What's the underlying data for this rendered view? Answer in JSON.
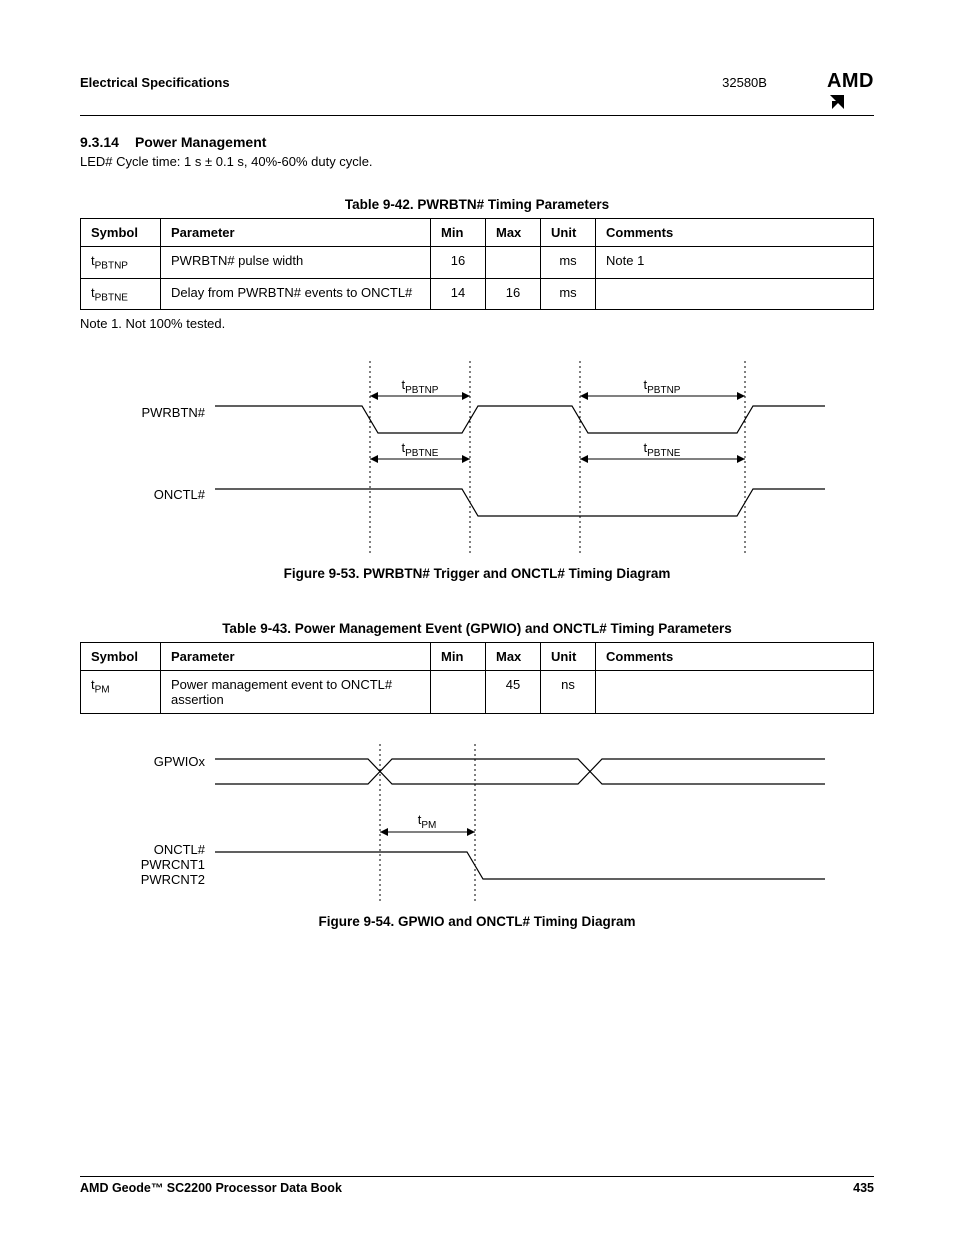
{
  "header": {
    "left": "Electrical Specifications",
    "docnum": "32580B",
    "logo": "AMD"
  },
  "section": {
    "num": "9.3.14",
    "title": "Power Management",
    "body": "LED# Cycle time: 1 s ± 0.1 s, 40%-60% duty cycle."
  },
  "table42": {
    "title": "Table 9-42.  PWRBTN# Timing Parameters",
    "headers": [
      "Symbol",
      "Parameter",
      "Min",
      "Max",
      "Unit",
      "Comments"
    ],
    "rows": [
      {
        "sym_base": "t",
        "sym_sub": "PBTNP",
        "param": "PWRBTN# pulse width",
        "min": "16",
        "max": "",
        "unit": "ms",
        "comm": "Note 1"
      },
      {
        "sym_base": "t",
        "sym_sub": "PBTNE",
        "param": "Delay from PWRBTN# events to ONCTL#",
        "min": "14",
        "max": "16",
        "unit": "ms",
        "comm": ""
      }
    ],
    "note": "Note 1.   Not 100% tested."
  },
  "figure53": {
    "caption": "Figure 9-53.  PWRBTN# Trigger and ONCTL# Timing Diagram",
    "signals": {
      "s1": "PWRBTN#",
      "s2": "ONCTL#"
    },
    "labels": {
      "t1_base": "t",
      "t1_sub": "PBTNP",
      "t2_base": "t",
      "t2_sub": "PBTNE"
    }
  },
  "table43": {
    "title": "Table 9-43.  Power Management Event (GPWIO) and ONCTL# Timing Parameters",
    "headers": [
      "Symbol",
      "Parameter",
      "Min",
      "Max",
      "Unit",
      "Comments"
    ],
    "rows": [
      {
        "sym_base": "t",
        "sym_sub": "PM",
        "param": "Power management event to ONCTL# assertion",
        "min": "",
        "max": "45",
        "unit": "ns",
        "comm": ""
      }
    ]
  },
  "figure54": {
    "caption": "Figure 9-54.  GPWIO and ONCTL# Timing Diagram",
    "signals": {
      "s1": "GPWIOx",
      "s2a": "ONCTL#",
      "s2b": "PWRCNT1",
      "s2c": "PWRCNT2"
    },
    "labels": {
      "t_base": "t",
      "t_sub": "PM"
    }
  },
  "footer": {
    "left": "AMD Geode™ SC2200  Processor Data Book",
    "right": "435"
  }
}
